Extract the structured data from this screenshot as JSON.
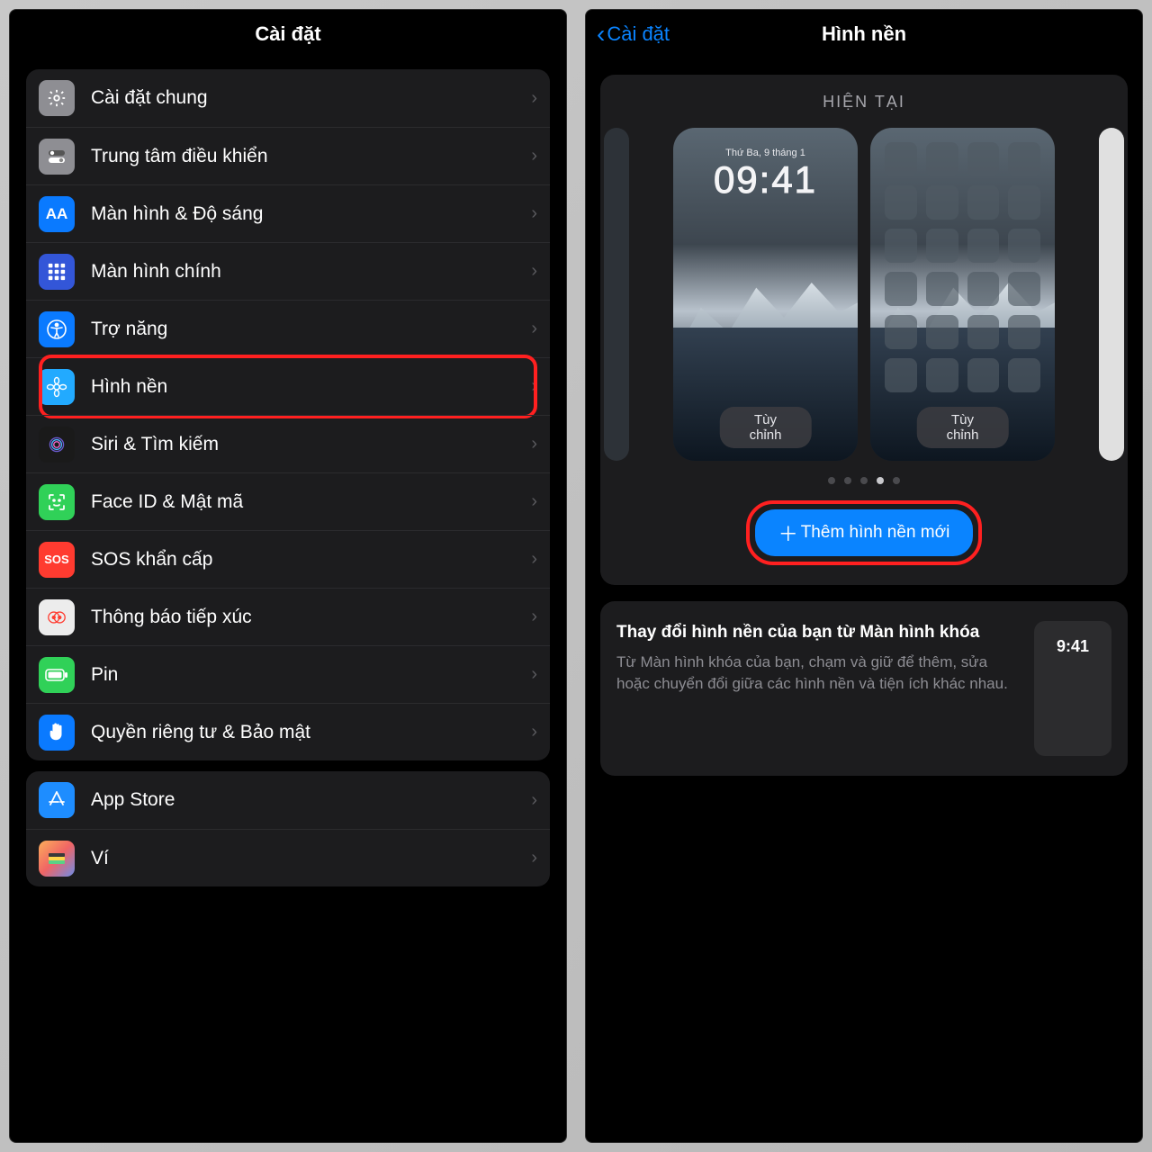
{
  "left": {
    "title": "Cài đặt",
    "groups": [
      [
        {
          "id": "general",
          "label": "Cài đặt chung",
          "bg": "bg-gray",
          "glyph": "gear"
        },
        {
          "id": "control-center",
          "label": "Trung tâm điều khiển",
          "bg": "bg-gray2",
          "glyph": "toggles"
        },
        {
          "id": "display",
          "label": "Màn hình & Độ sáng",
          "bg": "bg-blue",
          "glyph": "AA",
          "text": true
        },
        {
          "id": "home",
          "label": "Màn hình chính",
          "bg": "bg-indigo",
          "glyph": "grid"
        },
        {
          "id": "access",
          "label": "Trợ năng",
          "bg": "bg-blue2",
          "glyph": "access"
        },
        {
          "id": "wallpaper",
          "label": "Hình nền",
          "bg": "bg-cyan",
          "glyph": "flower",
          "hl": true
        },
        {
          "id": "siri",
          "label": "Siri & Tìm kiếm",
          "bg": "bg-black",
          "glyph": "siri"
        },
        {
          "id": "faceid",
          "label": "Face ID & Mật mã",
          "bg": "bg-green",
          "glyph": "face"
        },
        {
          "id": "sos",
          "label": "SOS khẩn cấp",
          "bg": "bg-red",
          "glyph": "SOS",
          "text": true
        },
        {
          "id": "exposure",
          "label": "Thông báo tiếp xúc",
          "bg": "bg-white",
          "glyph": "expo"
        },
        {
          "id": "battery",
          "label": "Pin",
          "bg": "bg-green2",
          "glyph": "battery"
        },
        {
          "id": "privacy",
          "label": "Quyền riêng tư & Bảo mật",
          "bg": "bg-blue3",
          "glyph": "hand"
        }
      ],
      [
        {
          "id": "appstore",
          "label": "App Store",
          "bg": "bg-blue4",
          "glyph": "appstore"
        },
        {
          "id": "wallet",
          "label": "Ví",
          "bg": "bg-wall",
          "glyph": "wallet"
        }
      ]
    ]
  },
  "right": {
    "back": "Cài đặt",
    "title": "Hình nền",
    "panel_title": "HIỆN TẠI",
    "lock_date": "Thứ Ba, 9 tháng 1",
    "lock_time": "09:41",
    "customize": "Tùy chỉnh",
    "dots": 5,
    "dot_active": 3,
    "add_label": "Thêm hình nền mới",
    "info_title": "Thay đổi hình nền của bạn từ Màn hình khóa",
    "info_body": "Từ Màn hình khóa của bạn, chạm và giữ để thêm, sửa hoặc chuyển đổi giữa các hình nền và tiện ích khác nhau.",
    "info_time": "9:41"
  }
}
